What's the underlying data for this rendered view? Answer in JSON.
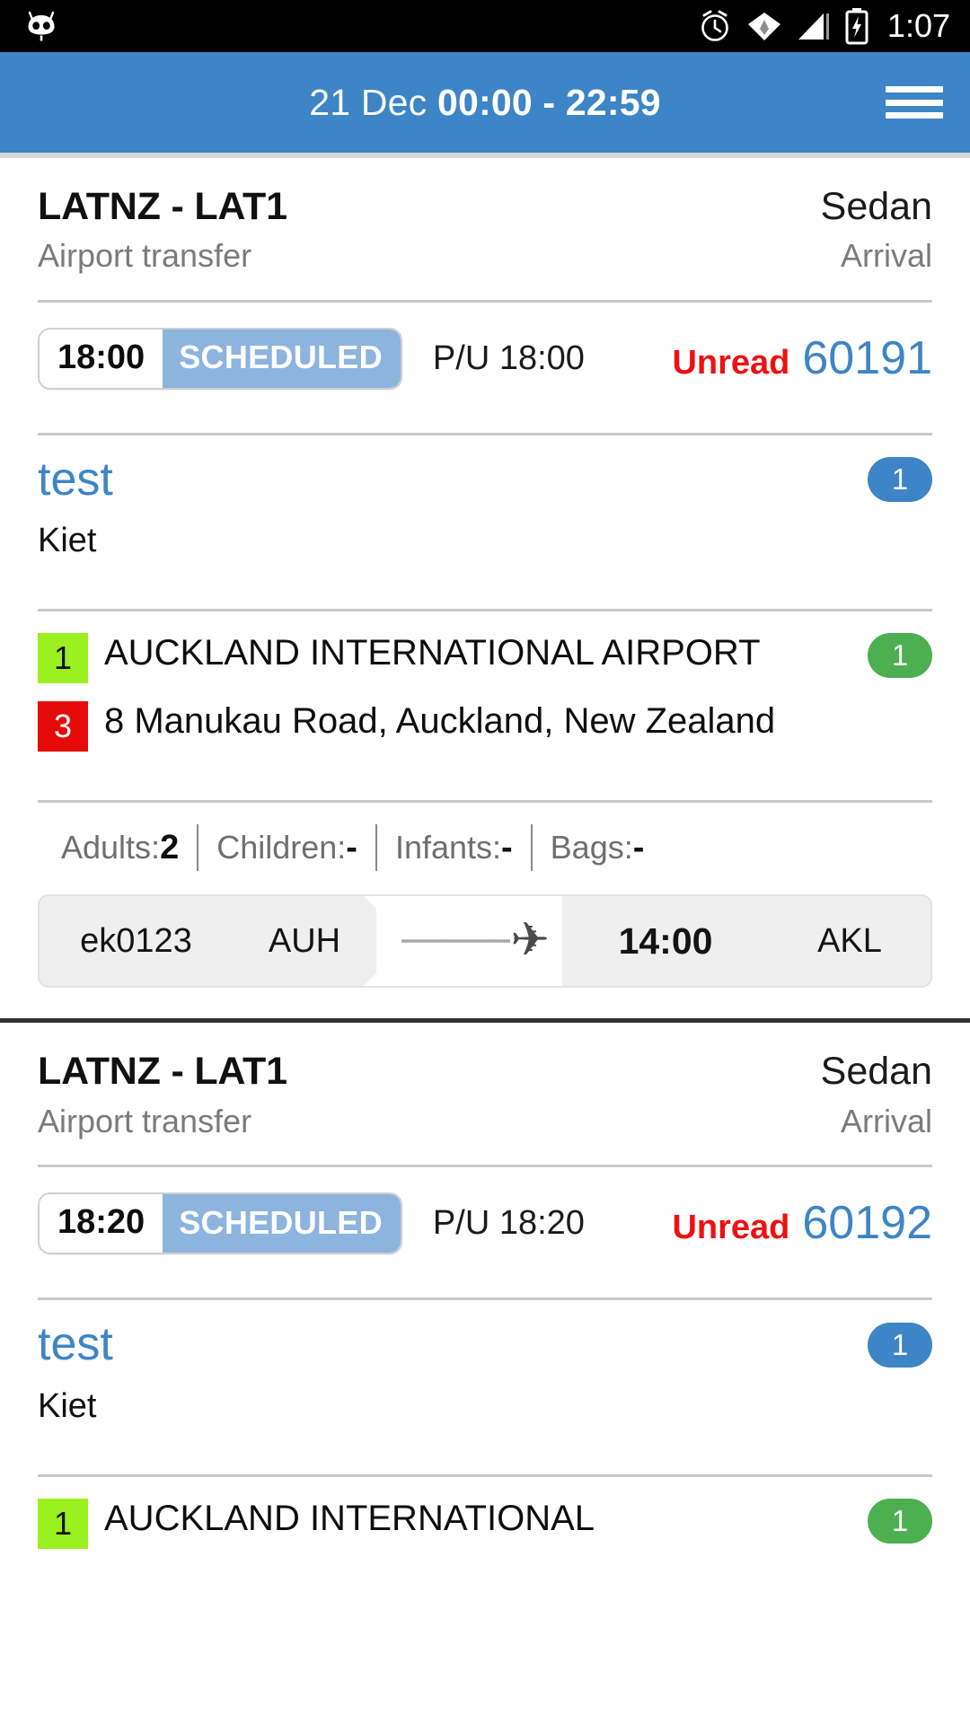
{
  "status_bar": {
    "logo_icon": "cyanogenmod-skull-icon",
    "icons": [
      "alarm-clock-icon",
      "wifi-icon",
      "cell-signal-icon",
      "battery-charging-icon"
    ],
    "time": "1:07"
  },
  "app_bar": {
    "date": "21 Dec",
    "time_range": "00:00 - 22:59",
    "menu_icon": "hamburger-menu-icon"
  },
  "colors": {
    "accent_blue": "#3d85c6",
    "status_pill_blue": "#8cb4dd",
    "unread_red": "#ee1111",
    "badge_green": "#4caf50",
    "pickup_lime": "#9bf01f",
    "dropoff_red": "#e50b0b"
  },
  "labels": {
    "adults": "Adults:",
    "children": "Children: ",
    "infants": "Infants:",
    "bags": "Bags:"
  },
  "jobs": [
    {
      "reference": "LATNZ - LAT1",
      "service_type": "Airport transfer",
      "vehicle": "Sedan",
      "direction": "Arrival",
      "time": "18:00",
      "status": "SCHEDULED",
      "pickup": "P/U 18:00",
      "unread": "Unread",
      "job_number": "60191",
      "customer": "test",
      "customer_badge": "1",
      "passenger": "Kiet",
      "stops": [
        {
          "seq": "1",
          "type": "pickup",
          "address": "AUCKLAND INTERNATIONAL AIRPORT",
          "badge": "1"
        },
        {
          "seq": "3",
          "type": "dropoff",
          "address": "8 Manukau Road, Auckland, New Zealand",
          "badge": ""
        }
      ],
      "pax": {
        "adults": "2",
        "children": "-",
        "infants": "-",
        "bags": "-"
      },
      "flight": {
        "number": "ek0123",
        "from": "AUH",
        "to": "AKL",
        "time": "14:00",
        "plane_icon": "airplane-icon"
      }
    },
    {
      "reference": "LATNZ - LAT1",
      "service_type": "Airport transfer",
      "vehicle": "Sedan",
      "direction": "Arrival",
      "time": "18:20",
      "status": "SCHEDULED",
      "pickup": "P/U 18:20",
      "unread": "Unread",
      "job_number": "60192",
      "customer": "test",
      "customer_badge": "1",
      "passenger": "Kiet",
      "stops": [
        {
          "seq": "1",
          "type": "pickup",
          "address": "AUCKLAND INTERNATIONAL",
          "badge": "1"
        }
      ]
    }
  ]
}
